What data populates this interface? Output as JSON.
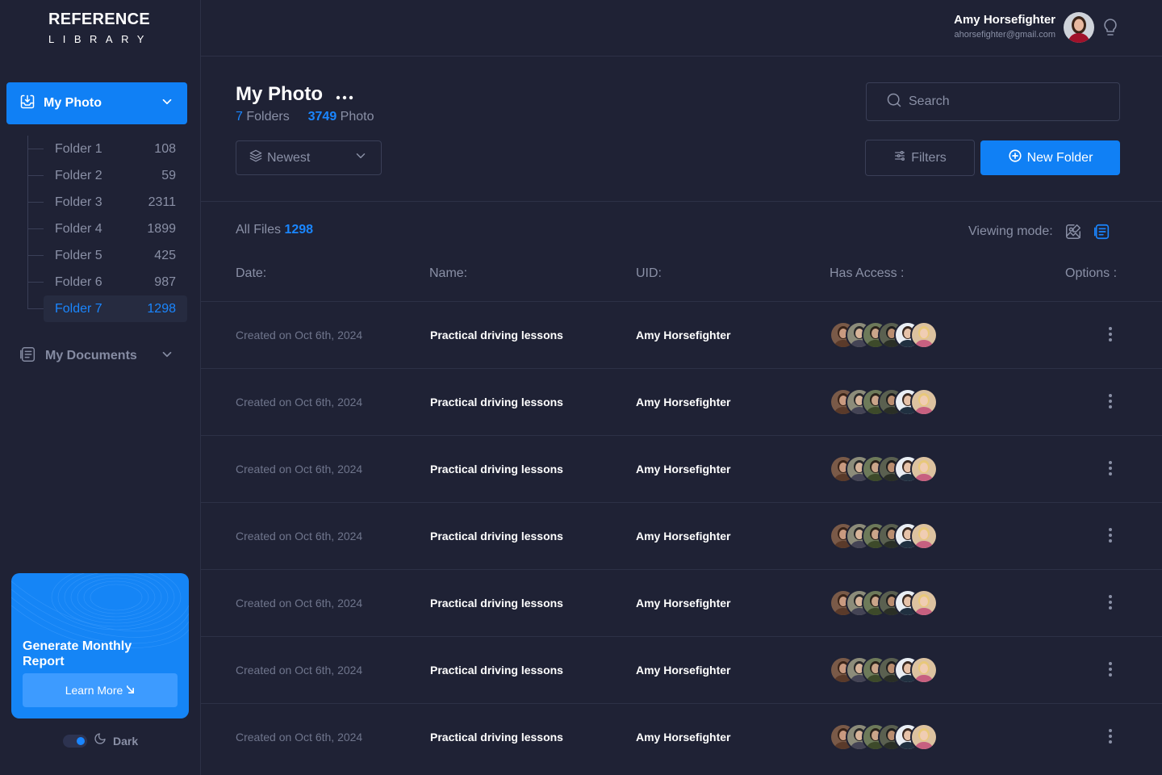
{
  "brand": {
    "line1": "REFERENCE",
    "line2": "LIBRARY"
  },
  "user": {
    "name": "Amy Horsefighter",
    "email": "ahorsefighter@gmail.com"
  },
  "sidebar": {
    "my_photo": "My Photo",
    "my_documents": "My Documents",
    "folders": [
      {
        "name": "Folder 1",
        "count": "108"
      },
      {
        "name": "Folder 2",
        "count": "59"
      },
      {
        "name": "Folder 3",
        "count": "2311"
      },
      {
        "name": "Folder 4",
        "count": "1899"
      },
      {
        "name": "Folder 5",
        "count": "425"
      },
      {
        "name": "Folder 6",
        "count": "987"
      },
      {
        "name": "Folder 7",
        "count": "1298"
      }
    ],
    "promo": {
      "title": "Generate Monthly Report",
      "button": "Learn More"
    },
    "theme_label": "Dark"
  },
  "header": {
    "title": "My Photo",
    "folders_count": "7",
    "folders_label": "Folders",
    "photo_count": "3749",
    "photo_label": "Photo",
    "sort": "Newest",
    "search_placeholder": "Search",
    "filters": "Filters",
    "new_folder": "New Folder"
  },
  "table": {
    "all_files_label": "All Files",
    "all_files_count": "1298",
    "viewing_mode": "Viewing mode:",
    "columns": {
      "date": "Date:",
      "name": "Name:",
      "uid": "UID:",
      "access": "Has Access :",
      "options": "Options :"
    },
    "rows": [
      {
        "date": "Created on Oct 6th, 2024",
        "name": "Practical driving lessons",
        "uid": "Amy Horsefighter"
      },
      {
        "date": "Created on Oct 6th, 2024",
        "name": "Practical driving lessons",
        "uid": "Amy Horsefighter"
      },
      {
        "date": "Created on Oct 6th, 2024",
        "name": "Practical driving lessons",
        "uid": "Amy Horsefighter"
      },
      {
        "date": "Created on Oct 6th, 2024",
        "name": "Practical driving lessons",
        "uid": "Amy Horsefighter"
      },
      {
        "date": "Created on Oct 6th, 2024",
        "name": "Practical driving lessons",
        "uid": "Amy Horsefighter"
      },
      {
        "date": "Created on Oct 6th, 2024",
        "name": "Practical driving lessons",
        "uid": "Amy Horsefighter"
      },
      {
        "date": "Created on Oct 6th, 2024",
        "name": "Practical driving lessons",
        "uid": "Amy Horsefighter"
      }
    ]
  },
  "colors": {
    "background": "#1f2235",
    "accent": "#1080f5",
    "muted": "#8a90a6"
  },
  "icons": [
    "download-box-icon",
    "chevron-down-icon",
    "document-icon",
    "moon-icon",
    "lightbulb-icon",
    "more-horizontal-icon",
    "layers-icon",
    "search-icon",
    "sliders-icon",
    "plus-circle-icon",
    "image-edit-icon",
    "list-view-icon",
    "more-vertical-icon",
    "arrow-down-right-icon"
  ]
}
